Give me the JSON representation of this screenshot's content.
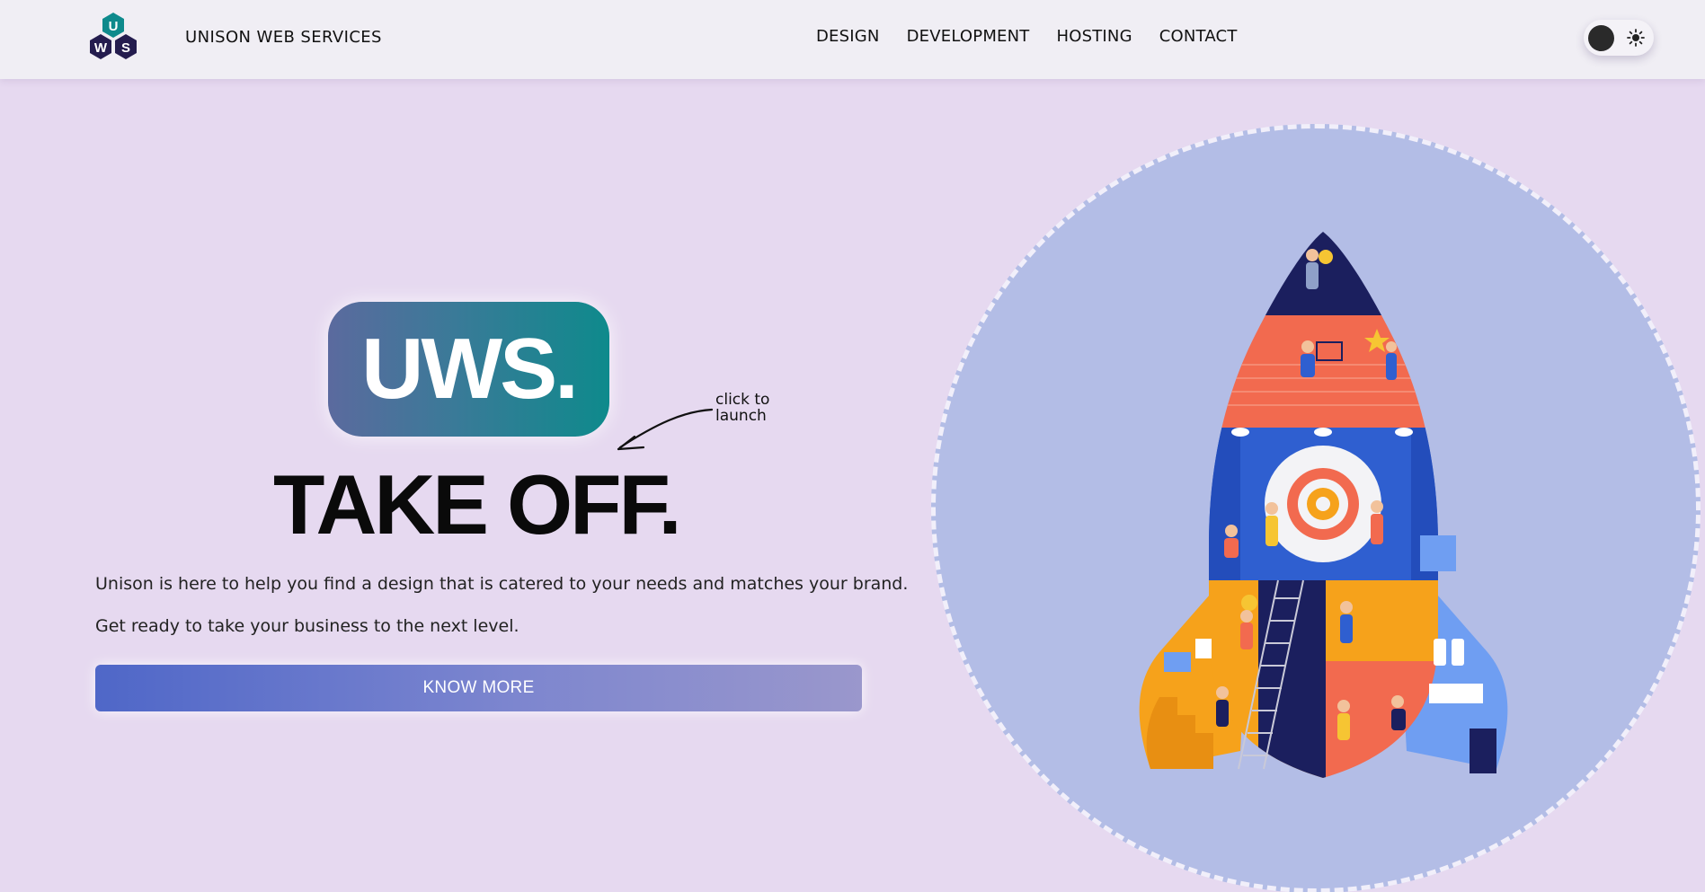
{
  "header": {
    "brand": "UNISON WEB SERVICES",
    "logo_letters": [
      "U",
      "W",
      "S"
    ],
    "nav": [
      "DESIGN",
      "DEVELOPMENT",
      "HOSTING",
      "CONTACT"
    ],
    "theme_toggle": {
      "state": "light",
      "icon_left": "moon-knob",
      "icon_right": "sun-icon"
    }
  },
  "hero": {
    "badge": "UWS.",
    "launch_note_line1": "click to",
    "launch_note_line2": "launch",
    "headline": "TAKE OFF.",
    "paragraph1": "Unison is here to help you find a design that is catered to your needs and matches your brand.",
    "paragraph2": "Get ready to take your business to the next level.",
    "cta": "KNOW MORE"
  },
  "colors": {
    "background": "#e6d9f0",
    "header_bg": "#f0eef4",
    "circle": "#b3bde6",
    "teal": "#0e8a8c",
    "navy": "#1b1f5e",
    "coral": "#f26a4f",
    "orange": "#f6a21b",
    "blue": "#2f5fd0"
  }
}
